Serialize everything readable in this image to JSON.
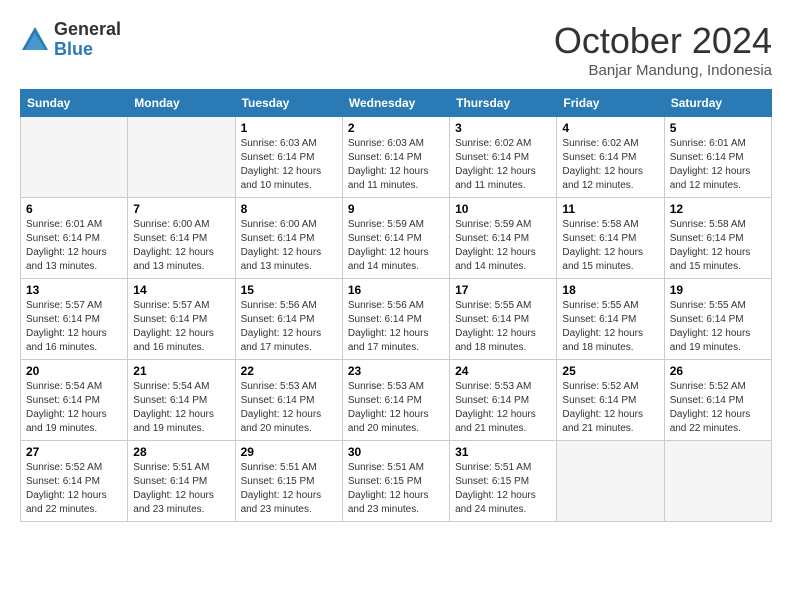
{
  "logo": {
    "general": "General",
    "blue": "Blue"
  },
  "header": {
    "month": "October 2024",
    "location": "Banjar Mandung, Indonesia"
  },
  "weekdays": [
    "Sunday",
    "Monday",
    "Tuesday",
    "Wednesday",
    "Thursday",
    "Friday",
    "Saturday"
  ],
  "weeks": [
    [
      {
        "day": "",
        "empty": true
      },
      {
        "day": "",
        "empty": true
      },
      {
        "day": "1",
        "sunrise": "6:03 AM",
        "sunset": "6:14 PM",
        "daylight": "12 hours and 10 minutes."
      },
      {
        "day": "2",
        "sunrise": "6:03 AM",
        "sunset": "6:14 PM",
        "daylight": "12 hours and 11 minutes."
      },
      {
        "day": "3",
        "sunrise": "6:02 AM",
        "sunset": "6:14 PM",
        "daylight": "12 hours and 11 minutes."
      },
      {
        "day": "4",
        "sunrise": "6:02 AM",
        "sunset": "6:14 PM",
        "daylight": "12 hours and 12 minutes."
      },
      {
        "day": "5",
        "sunrise": "6:01 AM",
        "sunset": "6:14 PM",
        "daylight": "12 hours and 12 minutes."
      }
    ],
    [
      {
        "day": "6",
        "sunrise": "6:01 AM",
        "sunset": "6:14 PM",
        "daylight": "12 hours and 13 minutes."
      },
      {
        "day": "7",
        "sunrise": "6:00 AM",
        "sunset": "6:14 PM",
        "daylight": "12 hours and 13 minutes."
      },
      {
        "day": "8",
        "sunrise": "6:00 AM",
        "sunset": "6:14 PM",
        "daylight": "12 hours and 13 minutes."
      },
      {
        "day": "9",
        "sunrise": "5:59 AM",
        "sunset": "6:14 PM",
        "daylight": "12 hours and 14 minutes."
      },
      {
        "day": "10",
        "sunrise": "5:59 AM",
        "sunset": "6:14 PM",
        "daylight": "12 hours and 14 minutes."
      },
      {
        "day": "11",
        "sunrise": "5:58 AM",
        "sunset": "6:14 PM",
        "daylight": "12 hours and 15 minutes."
      },
      {
        "day": "12",
        "sunrise": "5:58 AM",
        "sunset": "6:14 PM",
        "daylight": "12 hours and 15 minutes."
      }
    ],
    [
      {
        "day": "13",
        "sunrise": "5:57 AM",
        "sunset": "6:14 PM",
        "daylight": "12 hours and 16 minutes."
      },
      {
        "day": "14",
        "sunrise": "5:57 AM",
        "sunset": "6:14 PM",
        "daylight": "12 hours and 16 minutes."
      },
      {
        "day": "15",
        "sunrise": "5:56 AM",
        "sunset": "6:14 PM",
        "daylight": "12 hours and 17 minutes."
      },
      {
        "day": "16",
        "sunrise": "5:56 AM",
        "sunset": "6:14 PM",
        "daylight": "12 hours and 17 minutes."
      },
      {
        "day": "17",
        "sunrise": "5:55 AM",
        "sunset": "6:14 PM",
        "daylight": "12 hours and 18 minutes."
      },
      {
        "day": "18",
        "sunrise": "5:55 AM",
        "sunset": "6:14 PM",
        "daylight": "12 hours and 18 minutes."
      },
      {
        "day": "19",
        "sunrise": "5:55 AM",
        "sunset": "6:14 PM",
        "daylight": "12 hours and 19 minutes."
      }
    ],
    [
      {
        "day": "20",
        "sunrise": "5:54 AM",
        "sunset": "6:14 PM",
        "daylight": "12 hours and 19 minutes."
      },
      {
        "day": "21",
        "sunrise": "5:54 AM",
        "sunset": "6:14 PM",
        "daylight": "12 hours and 19 minutes."
      },
      {
        "day": "22",
        "sunrise": "5:53 AM",
        "sunset": "6:14 PM",
        "daylight": "12 hours and 20 minutes."
      },
      {
        "day": "23",
        "sunrise": "5:53 AM",
        "sunset": "6:14 PM",
        "daylight": "12 hours and 20 minutes."
      },
      {
        "day": "24",
        "sunrise": "5:53 AM",
        "sunset": "6:14 PM",
        "daylight": "12 hours and 21 minutes."
      },
      {
        "day": "25",
        "sunrise": "5:52 AM",
        "sunset": "6:14 PM",
        "daylight": "12 hours and 21 minutes."
      },
      {
        "day": "26",
        "sunrise": "5:52 AM",
        "sunset": "6:14 PM",
        "daylight": "12 hours and 22 minutes."
      }
    ],
    [
      {
        "day": "27",
        "sunrise": "5:52 AM",
        "sunset": "6:14 PM",
        "daylight": "12 hours and 22 minutes."
      },
      {
        "day": "28",
        "sunrise": "5:51 AM",
        "sunset": "6:14 PM",
        "daylight": "12 hours and 23 minutes."
      },
      {
        "day": "29",
        "sunrise": "5:51 AM",
        "sunset": "6:15 PM",
        "daylight": "12 hours and 23 minutes."
      },
      {
        "day": "30",
        "sunrise": "5:51 AM",
        "sunset": "6:15 PM",
        "daylight": "12 hours and 23 minutes."
      },
      {
        "day": "31",
        "sunrise": "5:51 AM",
        "sunset": "6:15 PM",
        "daylight": "12 hours and 24 minutes."
      },
      {
        "day": "",
        "empty": true
      },
      {
        "day": "",
        "empty": true
      }
    ]
  ],
  "labels": {
    "sunrise_prefix": "Sunrise: ",
    "sunset_prefix": "Sunset: ",
    "daylight_prefix": "Daylight: "
  }
}
